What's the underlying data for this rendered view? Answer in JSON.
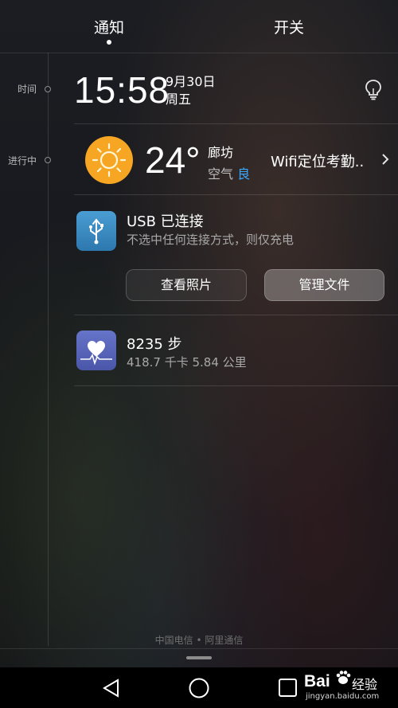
{
  "tabs": {
    "notify": "通知",
    "switch": "开关"
  },
  "timeline": {
    "time_label": "时间",
    "ongoing_label": "进行中"
  },
  "clock": {
    "time": "15:58",
    "date": "9月30日",
    "weekday": "周五"
  },
  "weather": {
    "temperature": "24°",
    "city": "廊坊",
    "air_label": "空气",
    "air_quality": "良",
    "air_quality_color": "#3aa8ff",
    "extra": "Wifi定位考勤.."
  },
  "usb": {
    "title": "USB 已连接",
    "subtitle": "不选中任何连接方式，则仅充电",
    "btn_photos": "查看照片",
    "btn_files": "管理文件"
  },
  "health": {
    "steps": "8235 步",
    "stats": "418.7 千卡   5.84 公里"
  },
  "carrier": "中国电信 • 阿里通信",
  "watermark": {
    "logo": "Bai",
    "jingyan": "经验",
    "url": "jingyan.baidu.com"
  },
  "icons": {
    "bulb": "lightbulb-icon",
    "sun": "sun-icon",
    "usb": "usb-icon",
    "health": "heart-pulse-icon",
    "back": "back-triangle-icon",
    "home": "home-circle-icon",
    "recent": "recent-square-icon"
  }
}
